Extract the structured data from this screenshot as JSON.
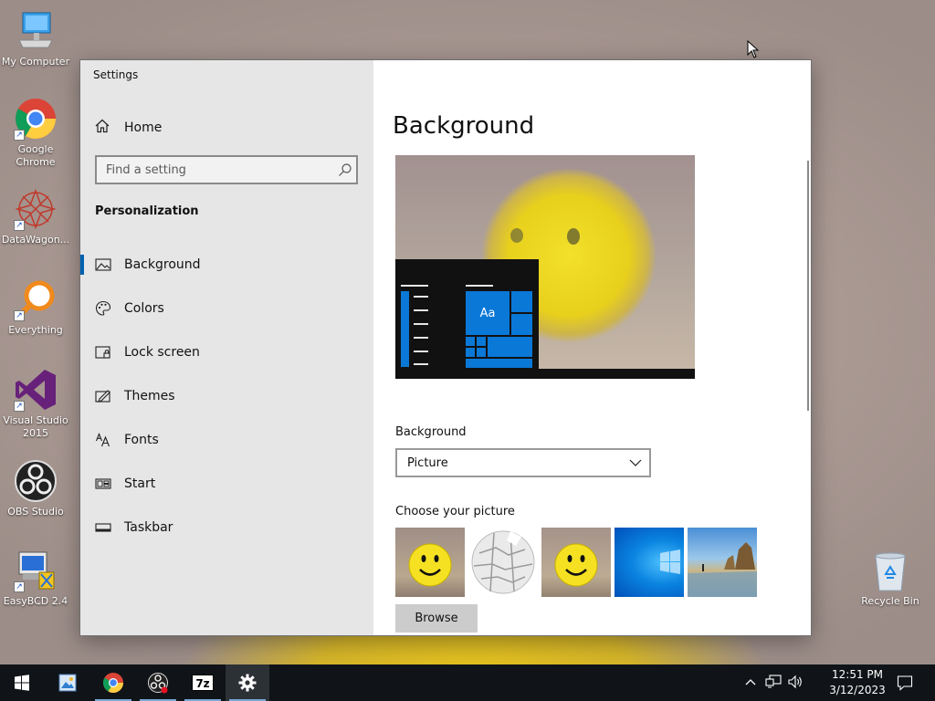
{
  "desktop": {
    "icons": [
      {
        "label": "My Computer"
      },
      {
        "label": "Google Chrome"
      },
      {
        "label": "DataWagon..."
      },
      {
        "label": "Everything"
      },
      {
        "label": "Visual Studio 2015"
      },
      {
        "label": "OBS Studio"
      },
      {
        "label": "EasyBCD 2.4"
      },
      {
        "label": "Recycle Bin"
      }
    ]
  },
  "window": {
    "title": "Settings",
    "controls": {
      "minimize": "minimize-icon",
      "maximize": "maximize-icon",
      "close": "close-icon"
    }
  },
  "sidebar": {
    "home_label": "Home",
    "search_placeholder": "Find a setting",
    "section_title": "Personalization",
    "items": [
      {
        "label": "Background",
        "icon": "picture-icon",
        "selected": true
      },
      {
        "label": "Colors",
        "icon": "palette-icon"
      },
      {
        "label": "Lock screen",
        "icon": "lock-screen-icon"
      },
      {
        "label": "Themes",
        "icon": "themes-icon"
      },
      {
        "label": "Fonts",
        "icon": "fonts-icon"
      },
      {
        "label": "Start",
        "icon": "start-icon"
      },
      {
        "label": "Taskbar",
        "icon": "taskbar-icon"
      }
    ]
  },
  "main": {
    "page_title": "Background",
    "preview_tile_label": "Aa",
    "background_label": "Background",
    "background_value": "Picture",
    "choose_label": "Choose your picture",
    "browse_label": "Browse"
  },
  "taskbar": {
    "time": "12:51 PM",
    "date": "3/12/2023",
    "apps": [
      "start-icon",
      "photos-icon",
      "chrome-icon",
      "obs-icon",
      "7zip-icon",
      "settings-icon"
    ],
    "sevenzip_label": "7z"
  },
  "colors": {
    "accent": "#0063b1",
    "tile_blue": "#0a78d7",
    "sidebar_bg": "#e6e6e6",
    "taskbar_bg": "#101418"
  }
}
